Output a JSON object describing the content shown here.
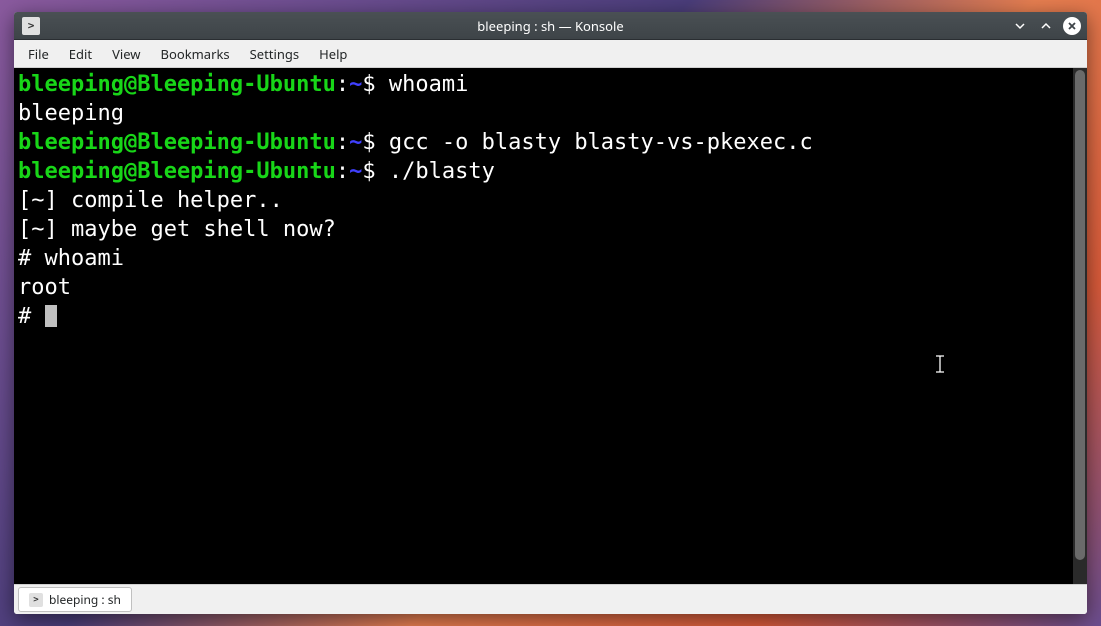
{
  "window": {
    "title": "bleeping : sh — Konsole"
  },
  "menubar": {
    "items": [
      "File",
      "Edit",
      "View",
      "Bookmarks",
      "Settings",
      "Help"
    ]
  },
  "terminal": {
    "lines": [
      {
        "user": "bleeping",
        "host": "Bleeping-Ubuntu",
        "path": "~",
        "prompt": "$",
        "cmd": "whoami"
      },
      {
        "output": "bleeping"
      },
      {
        "user": "bleeping",
        "host": "Bleeping-Ubuntu",
        "path": "~",
        "prompt": "$",
        "cmd": "gcc -o blasty blasty-vs-pkexec.c"
      },
      {
        "user": "bleeping",
        "host": "Bleeping-Ubuntu",
        "path": "~",
        "prompt": "$",
        "cmd": "./blasty"
      },
      {
        "output": "[~] compile helper.."
      },
      {
        "output": "[~] maybe get shell now?"
      },
      {
        "output": "# whoami"
      },
      {
        "output": "root"
      },
      {
        "output_cursor": "# "
      }
    ]
  },
  "tabbar": {
    "tabs": [
      {
        "label": "bleeping : sh"
      }
    ]
  },
  "iconGlyph": ">"
}
